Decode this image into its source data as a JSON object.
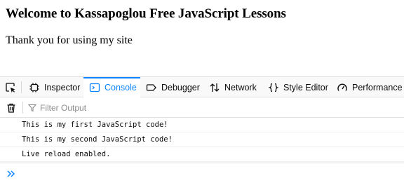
{
  "page": {
    "heading": "Welcome to Kassapoglou Free JavaScript Lessons",
    "paragraph": "Thank you for using my site"
  },
  "devtools": {
    "tabs": [
      {
        "label": "Inspector",
        "icon": "inspector-icon"
      },
      {
        "label": "Console",
        "icon": "console-icon",
        "active": true
      },
      {
        "label": "Debugger",
        "icon": "debugger-icon"
      },
      {
        "label": "Network",
        "icon": "network-icon"
      },
      {
        "label": "Style Editor",
        "icon": "style-editor-icon"
      },
      {
        "label": "Performance",
        "icon": "performance-icon"
      }
    ],
    "filter_placeholder": "Filter Output",
    "messages": [
      "This is my first JavaScript code!",
      "This is my second JavaScript code!",
      "Live reload enabled."
    ]
  },
  "colors": {
    "accent": "#0a84ff",
    "toolbar_bg": "#f9f9fa",
    "border": "#e0e0e2"
  }
}
